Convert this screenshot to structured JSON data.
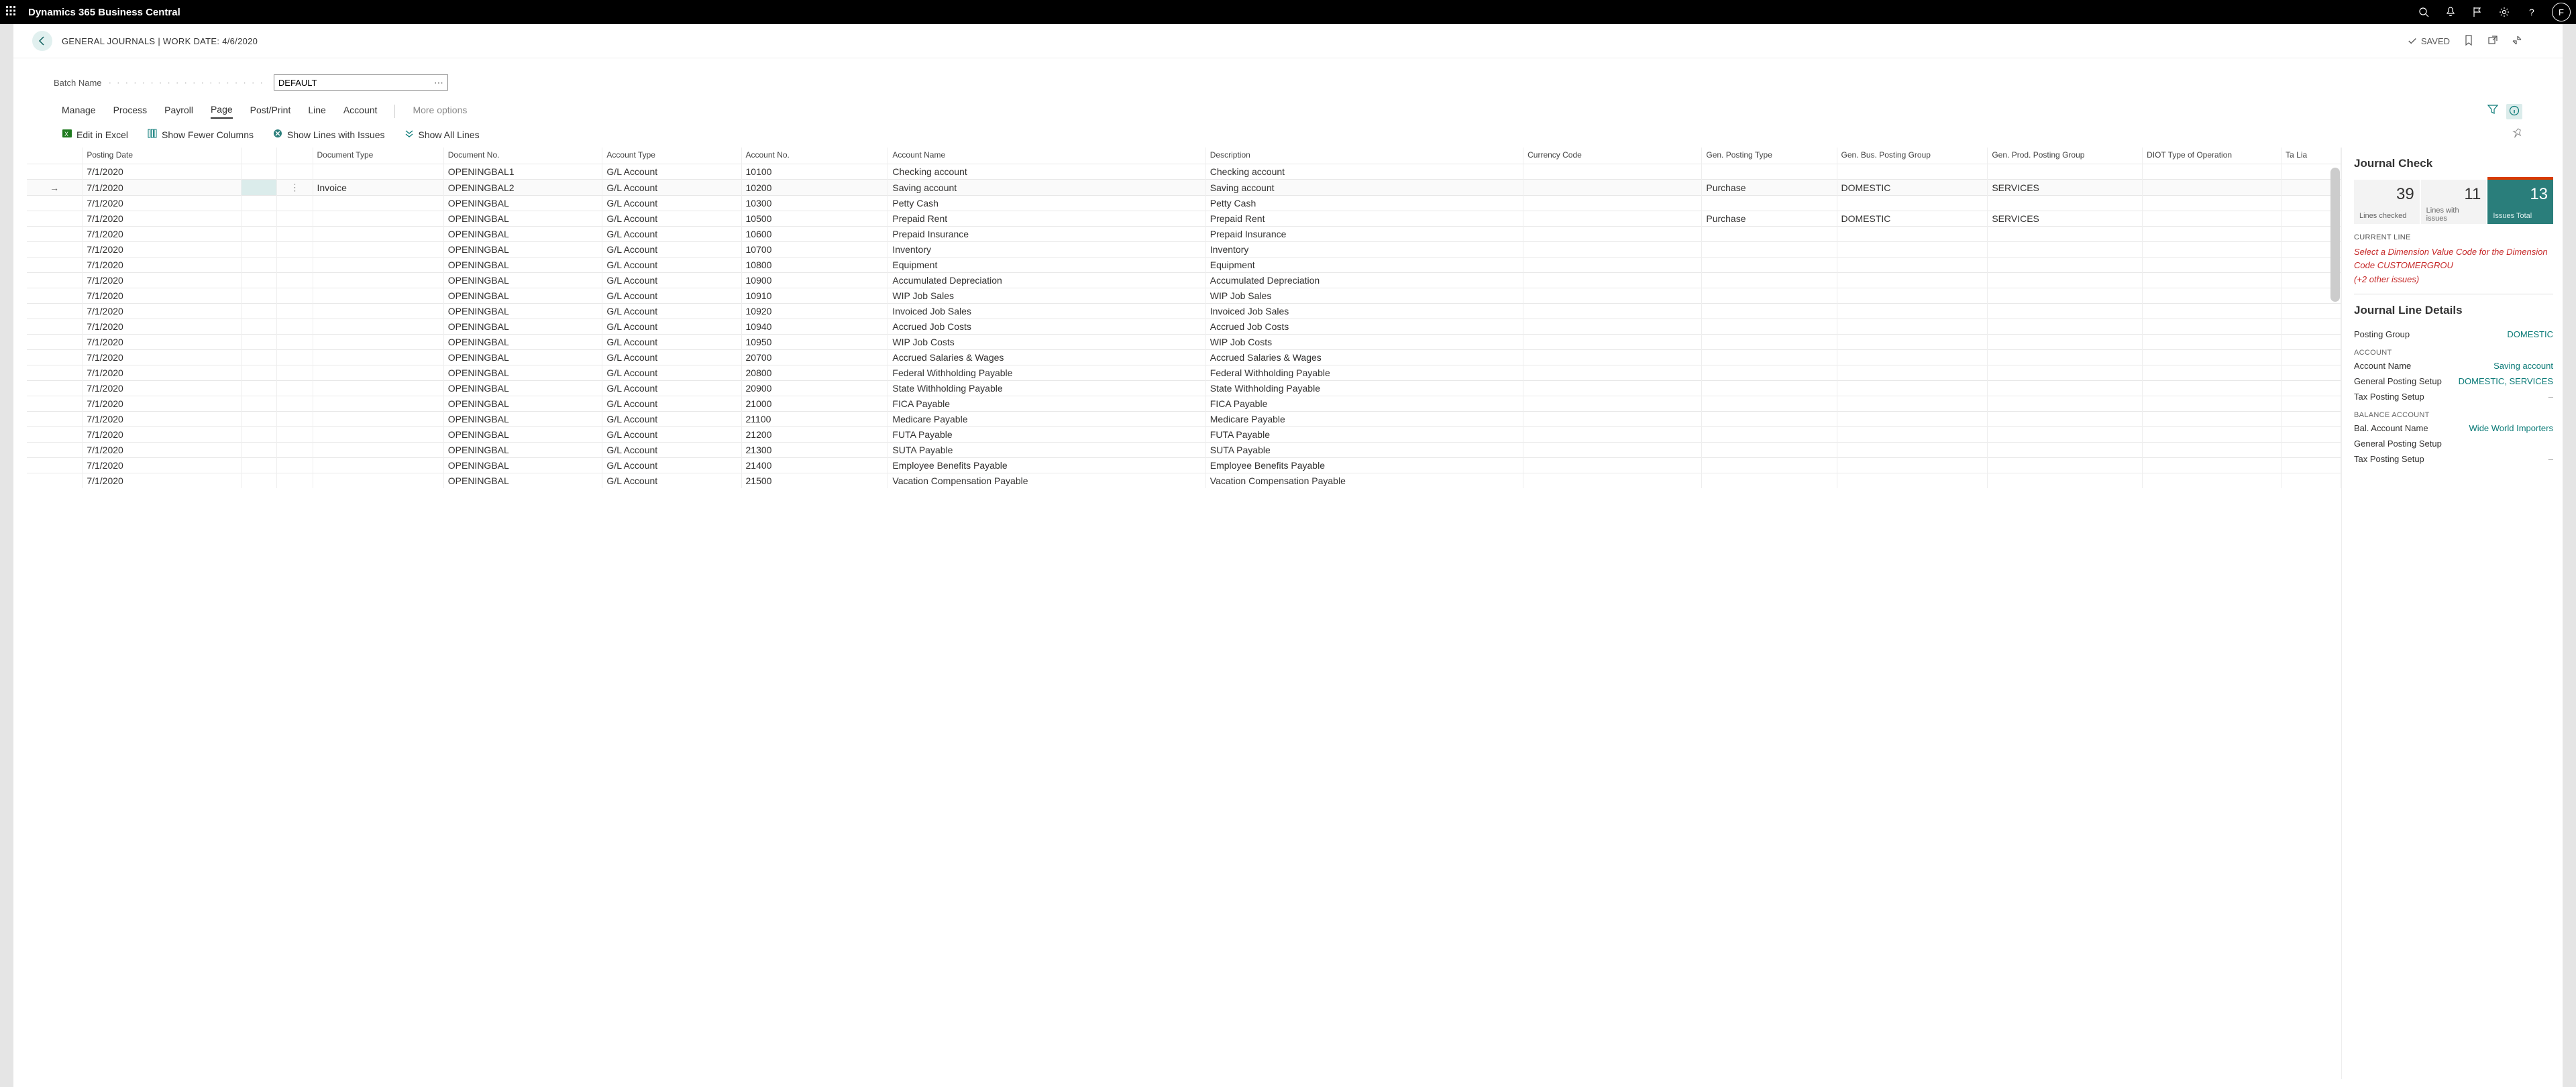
{
  "topbar": {
    "app_title": "Dynamics 365 Business Central",
    "avatar_initial": "F"
  },
  "page_header": {
    "title": "GENERAL JOURNALS | WORK DATE: 4/6/2020",
    "saved_label": "SAVED"
  },
  "batch": {
    "label": "Batch Name",
    "value": "DEFAULT"
  },
  "menu": {
    "items": [
      "Manage",
      "Process",
      "Payroll",
      "Page",
      "Post/Print",
      "Line",
      "Account"
    ],
    "active": "Page",
    "more": "More options"
  },
  "actions": {
    "edit_excel": "Edit in Excel",
    "fewer_cols": "Show Fewer Columns",
    "lines_issues": "Show Lines with Issues",
    "show_all": "Show All Lines"
  },
  "grid": {
    "headers": {
      "posting_date": "Posting Date",
      "doc_type": "Document Type",
      "doc_no": "Document No.",
      "acct_type": "Account Type",
      "acct_no": "Account No.",
      "acct_name": "Account Name",
      "description": "Description",
      "currency": "Currency Code",
      "gen_post_type": "Gen. Posting Type",
      "gen_bus": "Gen. Bus. Posting Group",
      "gen_prod": "Gen. Prod. Posting Group",
      "diot": "DIOT Type of Operation",
      "tax_lia": "Ta Lia"
    },
    "rows": [
      {
        "pd": "7/1/2020",
        "dt": "",
        "dn": "OPENINGBAL1",
        "at": "G/L Account",
        "an": "10100",
        "nm": "Checking account",
        "ds": "Checking account",
        "cc": "",
        "gpt": "",
        "gb": "",
        "gp": "",
        "di": "",
        "active": false
      },
      {
        "pd": "7/1/2020",
        "dt": "Invoice",
        "dn": "OPENINGBAL2",
        "at": "G/L Account",
        "an": "10200",
        "nm": "Saving account",
        "ds": "Saving account",
        "cc": "",
        "gpt": "Purchase",
        "gb": "DOMESTIC",
        "gp": "SERVICES",
        "di": "",
        "active": true
      },
      {
        "pd": "7/1/2020",
        "dt": "",
        "dn": "OPENINGBAL",
        "at": "G/L Account",
        "an": "10300",
        "nm": "Petty Cash",
        "ds": "Petty Cash",
        "cc": "",
        "gpt": "",
        "gb": "",
        "gp": "",
        "di": "",
        "active": false
      },
      {
        "pd": "7/1/2020",
        "dt": "",
        "dn": "OPENINGBAL",
        "at": "G/L Account",
        "an": "10500",
        "nm": "Prepaid Rent",
        "ds": "Prepaid Rent",
        "cc": "",
        "gpt": "Purchase",
        "gb": "DOMESTIC",
        "gp": "SERVICES",
        "di": "",
        "active": false
      },
      {
        "pd": "7/1/2020",
        "dt": "",
        "dn": "OPENINGBAL",
        "at": "G/L Account",
        "an": "10600",
        "nm": "Prepaid Insurance",
        "ds": "Prepaid Insurance",
        "cc": "",
        "gpt": "",
        "gb": "",
        "gp": "",
        "di": "",
        "active": false
      },
      {
        "pd": "7/1/2020",
        "dt": "",
        "dn": "OPENINGBAL",
        "at": "G/L Account",
        "an": "10700",
        "nm": "Inventory",
        "ds": "Inventory",
        "cc": "",
        "gpt": "",
        "gb": "",
        "gp": "",
        "di": "",
        "active": false
      },
      {
        "pd": "7/1/2020",
        "dt": "",
        "dn": "OPENINGBAL",
        "at": "G/L Account",
        "an": "10800",
        "nm": "Equipment",
        "ds": "Equipment",
        "cc": "",
        "gpt": "",
        "gb": "",
        "gp": "",
        "di": "",
        "active": false
      },
      {
        "pd": "7/1/2020",
        "dt": "",
        "dn": "OPENINGBAL",
        "at": "G/L Account",
        "an": "10900",
        "nm": "Accumulated Depreciation",
        "ds": "Accumulated Depreciation",
        "cc": "",
        "gpt": "",
        "gb": "",
        "gp": "",
        "di": "",
        "active": false
      },
      {
        "pd": "7/1/2020",
        "dt": "",
        "dn": "OPENINGBAL",
        "at": "G/L Account",
        "an": "10910",
        "nm": "WIP Job Sales",
        "ds": "WIP Job Sales",
        "cc": "",
        "gpt": "",
        "gb": "",
        "gp": "",
        "di": "",
        "active": false
      },
      {
        "pd": "7/1/2020",
        "dt": "",
        "dn": "OPENINGBAL",
        "at": "G/L Account",
        "an": "10920",
        "nm": "Invoiced Job Sales",
        "ds": "Invoiced Job Sales",
        "cc": "",
        "gpt": "",
        "gb": "",
        "gp": "",
        "di": "",
        "active": false
      },
      {
        "pd": "7/1/2020",
        "dt": "",
        "dn": "OPENINGBAL",
        "at": "G/L Account",
        "an": "10940",
        "nm": "Accrued Job Costs",
        "ds": "Accrued Job Costs",
        "cc": "",
        "gpt": "",
        "gb": "",
        "gp": "",
        "di": "",
        "active": false
      },
      {
        "pd": "7/1/2020",
        "dt": "",
        "dn": "OPENINGBAL",
        "at": "G/L Account",
        "an": "10950",
        "nm": "WIP Job Costs",
        "ds": "WIP Job Costs",
        "cc": "",
        "gpt": "",
        "gb": "",
        "gp": "",
        "di": "",
        "active": false
      },
      {
        "pd": "7/1/2020",
        "dt": "",
        "dn": "OPENINGBAL",
        "at": "G/L Account",
        "an": "20700",
        "nm": "Accrued Salaries & Wages",
        "ds": "Accrued Salaries & Wages",
        "cc": "",
        "gpt": "",
        "gb": "",
        "gp": "",
        "di": "",
        "active": false
      },
      {
        "pd": "7/1/2020",
        "dt": "",
        "dn": "OPENINGBAL",
        "at": "G/L Account",
        "an": "20800",
        "nm": "Federal Withholding Payable",
        "ds": "Federal Withholding Payable",
        "cc": "",
        "gpt": "",
        "gb": "",
        "gp": "",
        "di": "",
        "active": false
      },
      {
        "pd": "7/1/2020",
        "dt": "",
        "dn": "OPENINGBAL",
        "at": "G/L Account",
        "an": "20900",
        "nm": "State Withholding Payable",
        "ds": "State Withholding Payable",
        "cc": "",
        "gpt": "",
        "gb": "",
        "gp": "",
        "di": "",
        "active": false
      },
      {
        "pd": "7/1/2020",
        "dt": "",
        "dn": "OPENINGBAL",
        "at": "G/L Account",
        "an": "21000",
        "nm": "FICA Payable",
        "ds": "FICA Payable",
        "cc": "",
        "gpt": "",
        "gb": "",
        "gp": "",
        "di": "",
        "active": false
      },
      {
        "pd": "7/1/2020",
        "dt": "",
        "dn": "OPENINGBAL",
        "at": "G/L Account",
        "an": "21100",
        "nm": "Medicare Payable",
        "ds": "Medicare Payable",
        "cc": "",
        "gpt": "",
        "gb": "",
        "gp": "",
        "di": "",
        "active": false
      },
      {
        "pd": "7/1/2020",
        "dt": "",
        "dn": "OPENINGBAL",
        "at": "G/L Account",
        "an": "21200",
        "nm": "FUTA Payable",
        "ds": "FUTA Payable",
        "cc": "",
        "gpt": "",
        "gb": "",
        "gp": "",
        "di": "",
        "active": false
      },
      {
        "pd": "7/1/2020",
        "dt": "",
        "dn": "OPENINGBAL",
        "at": "G/L Account",
        "an": "21300",
        "nm": "SUTA Payable",
        "ds": "SUTA Payable",
        "cc": "",
        "gpt": "",
        "gb": "",
        "gp": "",
        "di": "",
        "active": false
      },
      {
        "pd": "7/1/2020",
        "dt": "",
        "dn": "OPENINGBAL",
        "at": "G/L Account",
        "an": "21400",
        "nm": "Employee Benefits Payable",
        "ds": "Employee Benefits Payable",
        "cc": "",
        "gpt": "",
        "gb": "",
        "gp": "",
        "di": "",
        "active": false
      },
      {
        "pd": "7/1/2020",
        "dt": "",
        "dn": "OPENINGBAL",
        "at": "G/L Account",
        "an": "21500",
        "nm": "Vacation Compensation Payable",
        "ds": "Vacation Compensation Payable",
        "cc": "",
        "gpt": "",
        "gb": "",
        "gp": "",
        "di": "",
        "active": false
      }
    ]
  },
  "factbox": {
    "journal_check_title": "Journal Check",
    "tiles": [
      {
        "num": "39",
        "label": "Lines checked"
      },
      {
        "num": "11",
        "label": "Lines with issues"
      },
      {
        "num": "13",
        "label": "Issues Total"
      }
    ],
    "current_line_label": "CURRENT LINE",
    "issue_text": "Select a Dimension Value Code for the Dimension Code CUSTOMERGROU",
    "issue_more": "(+2 other issues)",
    "details_title": "Journal Line Details",
    "posting_group_label": "Posting Group",
    "posting_group_value": "DOMESTIC",
    "account_section": "ACCOUNT",
    "account_name_label": "Account Name",
    "account_name_value": "Saving account",
    "gps_label": "General Posting Setup",
    "gps_value": "DOMESTIC, SERVICES",
    "tps_label": "Tax Posting Setup",
    "tps_value": "–",
    "balance_section": "BALANCE ACCOUNT",
    "bal_name_label": "Bal. Account Name",
    "bal_name_value": "Wide World Importers",
    "bal_gps_label": "General Posting Setup",
    "bal_tps_label": "Tax Posting Setup",
    "bal_tps_value": "–"
  }
}
